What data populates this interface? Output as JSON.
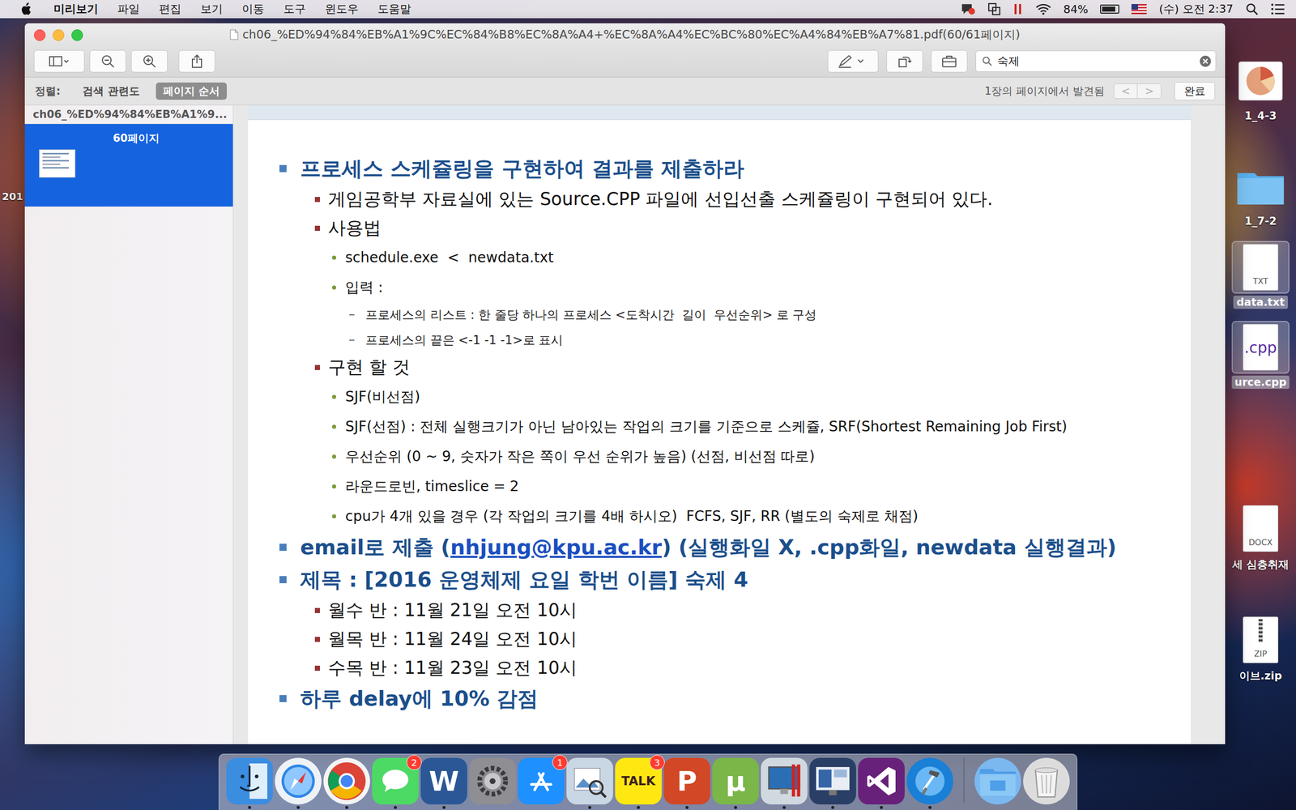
{
  "menubar": {
    "app": "미리보기",
    "menus": [
      "파일",
      "편집",
      "보기",
      "이동",
      "도구",
      "윈도우",
      "도움말"
    ],
    "battery": "84%",
    "battery_level": 0.84,
    "clock": "(수) 오전 2:37"
  },
  "window": {
    "title": "ch06_%ED%94%84%EB%A1%9C%EC%84%B8%EC%8A%A4+%EC%8A%A4%EC%BC%80%EC%A4%84%EB%A7%81.pdf(60/61페이지)",
    "search": {
      "value": "숙제"
    },
    "findbar": {
      "sort_label": "정렬:",
      "sort_options": [
        {
          "label": "검색 관련도",
          "selected": false
        },
        {
          "label": "페이지 순서",
          "selected": true
        }
      ],
      "result": "1장의 페이지에서 발견됨",
      "prev": "<",
      "next": ">",
      "done": "완료"
    },
    "sidebar": {
      "header": "ch06_%ED%94%84%EB%A1%9...",
      "pages": [
        {
          "label": "60페이지",
          "selected": true
        }
      ]
    },
    "document": {
      "items": [
        {
          "level": 1,
          "parts": [
            {
              "text": "프로세스 스케쥴링을 구현하여 결과를 제출하라",
              "link": false
            }
          ]
        },
        {
          "level": 2,
          "parts": [
            {
              "text": "게임공학부 자료실에 있는 Source.CPP 파일에 선입선출 스케쥴링이 구현되어 있다.",
              "link": false
            }
          ]
        },
        {
          "level": 2,
          "parts": [
            {
              "text": "사용법",
              "link": false
            }
          ]
        },
        {
          "level": 3,
          "parts": [
            {
              "text": "schedule.exe  <  newdata.txt",
              "link": false
            }
          ]
        },
        {
          "level": 3,
          "parts": [
            {
              "text": "입력 :",
              "link": false
            }
          ]
        },
        {
          "level": 4,
          "parts": [
            {
              "text": "프로세스의 리스트 : 한 줄당 하나의 프로세스 <도착시간  길이  우선순위> 로 구성",
              "link": false
            }
          ]
        },
        {
          "level": 4,
          "parts": [
            {
              "text": "프로세스의 끝은 <-1 -1 -1>로 표시",
              "link": false
            }
          ]
        },
        {
          "level": 2,
          "parts": [
            {
              "text": "구현 할 것",
              "link": false
            }
          ]
        },
        {
          "level": 3,
          "parts": [
            {
              "text": "SJF(비선점)",
              "link": false
            }
          ]
        },
        {
          "level": 3,
          "parts": [
            {
              "text": "SJF(선점) : 전체 실행크기가 아닌 남아있는 작업의 크기를 기준으로 스케쥴, SRF(Shortest Remaining Job First)",
              "link": false
            }
          ]
        },
        {
          "level": 3,
          "parts": [
            {
              "text": "우선순위 (0 ~ 9, 숫자가 작은 쪽이 우선 순위가 높음) (선점, 비선점 따로)",
              "link": false
            }
          ]
        },
        {
          "level": 3,
          "parts": [
            {
              "text": "라운드로빈, timeslice = 2",
              "link": false
            }
          ]
        },
        {
          "level": 3,
          "parts": [
            {
              "text": "cpu가 4개 있을 경우 (각 작업의 크기를 4배 하시오)  FCFS, SJF, RR (별도의 숙제로 채점)",
              "link": false
            }
          ]
        },
        {
          "level": 1,
          "parts": [
            {
              "text": "email로 제출 (",
              "link": false
            },
            {
              "text": "nhjung@kpu.ac.kr",
              "link": true
            },
            {
              "text": ") (실행화일 X, .cpp화일, newdata 실행결과)",
              "link": false
            }
          ]
        },
        {
          "level": 1,
          "parts": [
            {
              "text": "제목 : [2016 운영체제 요일 학번 이름] 숙제 4",
              "link": false
            }
          ]
        },
        {
          "level": 2,
          "parts": [
            {
              "text": "월수 반 : 11월 21일 오전 10시",
              "link": false
            }
          ]
        },
        {
          "level": 2,
          "parts": [
            {
              "text": "월목 반 : 11월 24일 오전 10시",
              "link": false
            }
          ]
        },
        {
          "level": 2,
          "parts": [
            {
              "text": "수목 반 : 11월 23일 오전 10시",
              "link": false
            }
          ]
        },
        {
          "level": 1,
          "parts": [
            {
              "text": "하루 delay에 10% 감점",
              "link": false
            }
          ]
        }
      ]
    }
  },
  "desktop_left": [
    {
      "label": "201"
    }
  ],
  "desktop_icons": [
    {
      "label": "1_4-3",
      "kind": "image",
      "selected": false
    },
    {
      "label": "1_7-2",
      "kind": "folder",
      "selected": false
    },
    {
      "label": "data.txt",
      "kind": "file",
      "tag": "TXT",
      "selected": true
    },
    {
      "label": "urce.cpp",
      "kind": "code",
      "tag": ".cpp",
      "selected": true
    },
    {
      "label": "세 심층취재",
      "kind": "file",
      "tag": "DOCX",
      "selected": false
    },
    {
      "label": "이브.zip",
      "kind": "zip",
      "tag": "ZIP",
      "selected": false
    }
  ],
  "dock": [
    {
      "kind": "finder",
      "color": "#3b8de0",
      "running": true
    },
    {
      "kind": "safari",
      "color": "#eef2f7",
      "running": true
    },
    {
      "kind": "chrome",
      "color": "#f4f4f4",
      "running": true
    },
    {
      "kind": "messages",
      "color": "#4cd964",
      "badge": "2",
      "running": true
    },
    {
      "kind": "word",
      "color": "#2b5797",
      "glyph": "W",
      "running": true
    },
    {
      "kind": "gear",
      "color": "#8e8e93",
      "running": false
    },
    {
      "kind": "appstore",
      "color": "#1e90ff",
      "badge": "1",
      "running": false
    },
    {
      "kind": "preview",
      "color": "#c9d6e3",
      "running": true
    },
    {
      "kind": "talk",
      "color": "#ffe812",
      "glyph": "TALK",
      "badge": "3",
      "running": true
    },
    {
      "kind": "ppt",
      "color": "#d24726",
      "glyph": "P",
      "running": true
    },
    {
      "kind": "utorrent",
      "color": "#7ab648",
      "glyph": "µ",
      "running": true
    },
    {
      "kind": "screen",
      "color": "#d0d8e0",
      "running": true
    },
    {
      "kind": "monitor",
      "color": "#2a3f66",
      "running": true
    },
    {
      "kind": "vs",
      "color": "#68217a",
      "running": true
    },
    {
      "kind": "xcode",
      "color": "#1a7fd6",
      "running": true
    },
    {
      "kind": "folder",
      "color": "#7cb8f0",
      "running": false
    },
    {
      "kind": "trash",
      "color": "#dcdcdc",
      "running": false
    }
  ]
}
